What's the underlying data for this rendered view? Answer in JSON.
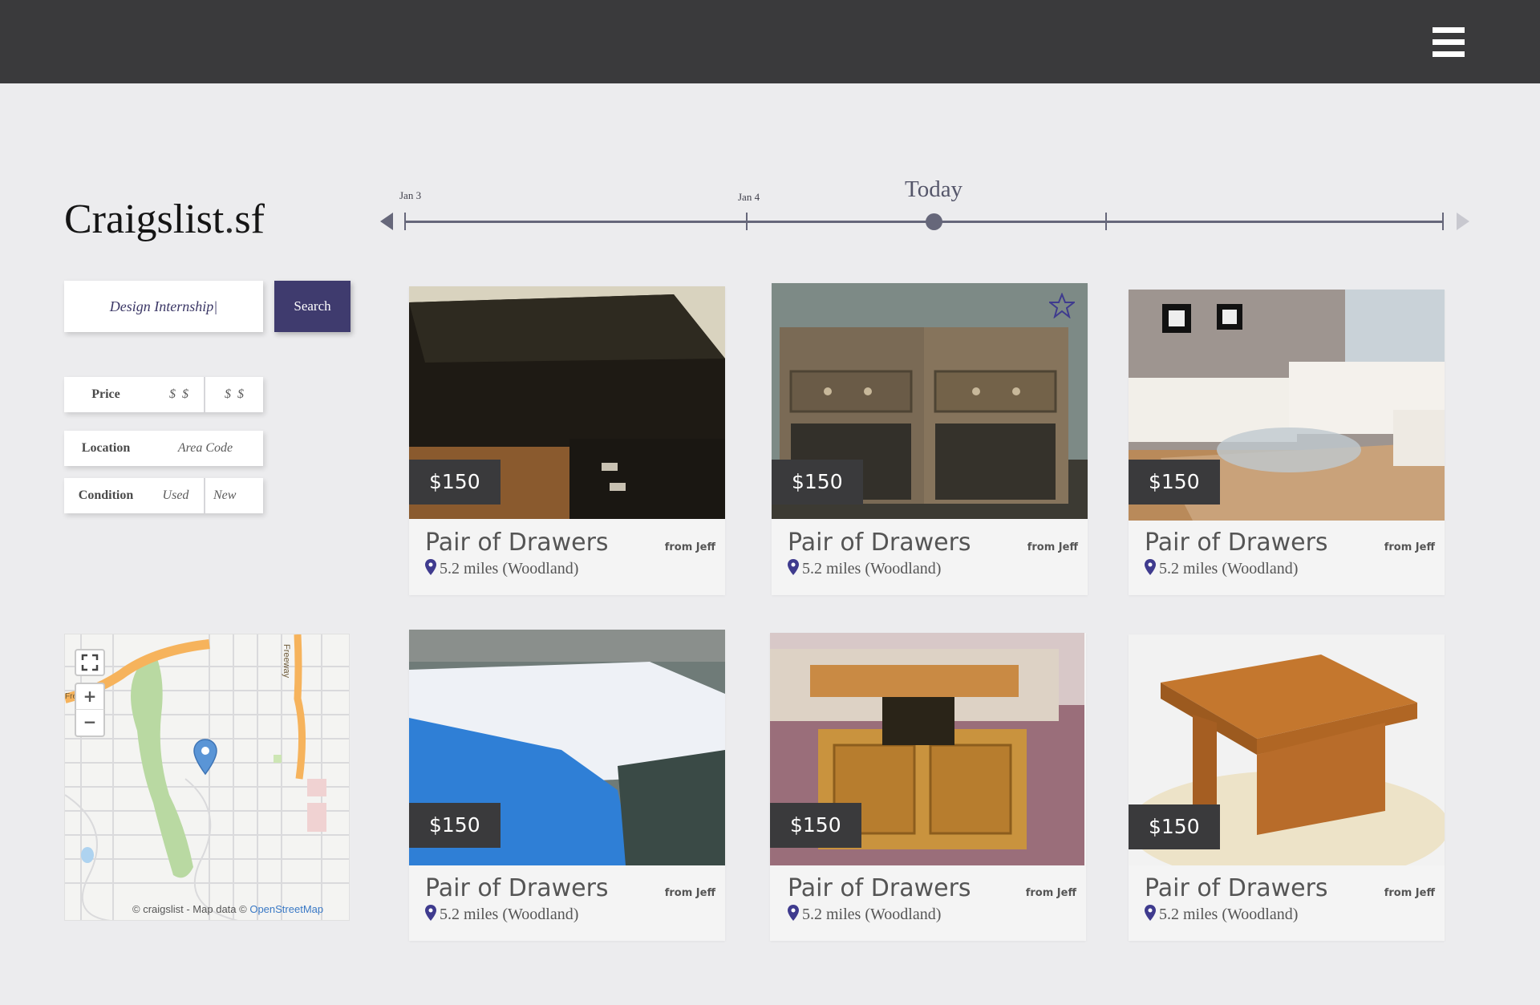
{
  "header": {
    "menu_icon": "hamburger-menu-icon"
  },
  "logo": {
    "name": "Craigslist",
    "dot": ".",
    "city": "sf"
  },
  "timeline": {
    "labels": [
      {
        "text": "Jan 3"
      },
      {
        "text": "Jan 4"
      }
    ],
    "today_label": "Today"
  },
  "search": {
    "value": "Design Internship|",
    "button_label": "Search"
  },
  "filters": {
    "price": {
      "label": "Price",
      "min": "  $  $",
      "max": "$  $"
    },
    "location": {
      "label": "Location",
      "placeholder": "Area Code"
    },
    "condition": {
      "label": "Condition",
      "option_used": "Used",
      "option_new": "New"
    }
  },
  "map": {
    "zoom_in": "+",
    "zoom_out": "−",
    "road_label": "Freeway",
    "road_label_left": "Fre",
    "attribution_prefix": "© craigslist - Map data © ",
    "attribution_link": "OpenStreetMap"
  },
  "listings": [
    {
      "price": "$150",
      "title": "Pair of Drawers",
      "from": "from Jeff",
      "distance": "5.2 miles (Woodland)",
      "image": "black-dresser"
    },
    {
      "price": "$150",
      "title": "Pair of Drawers",
      "from": "from Jeff",
      "distance": "5.2 miles (Woodland)",
      "image": "wooden-nightstands",
      "starred": false
    },
    {
      "price": "$150",
      "title": "Pair of Drawers",
      "from": "from Jeff",
      "distance": "5.2 miles (Woodland)",
      "image": "white-sectional-sofa"
    },
    {
      "price": "$150",
      "title": "Pair of Drawers",
      "from": "from Jeff",
      "distance": "5.2 miles (Woodland)",
      "image": "mattress-in-plastic"
    },
    {
      "price": "$150",
      "title": "Pair of Drawers",
      "from": "from Jeff",
      "distance": "5.2 miles (Woodland)",
      "image": "lift-top-coffee-table"
    },
    {
      "price": "$150",
      "title": "Pair of Drawers",
      "from": "from Jeff",
      "distance": "5.2 miles (Woodland)",
      "image": "wooden-side-table"
    }
  ],
  "colors": {
    "accent": "#3f3b6e",
    "header": "#3a3a3c",
    "pin": "#3f3b8e",
    "background": "#ececee"
  }
}
